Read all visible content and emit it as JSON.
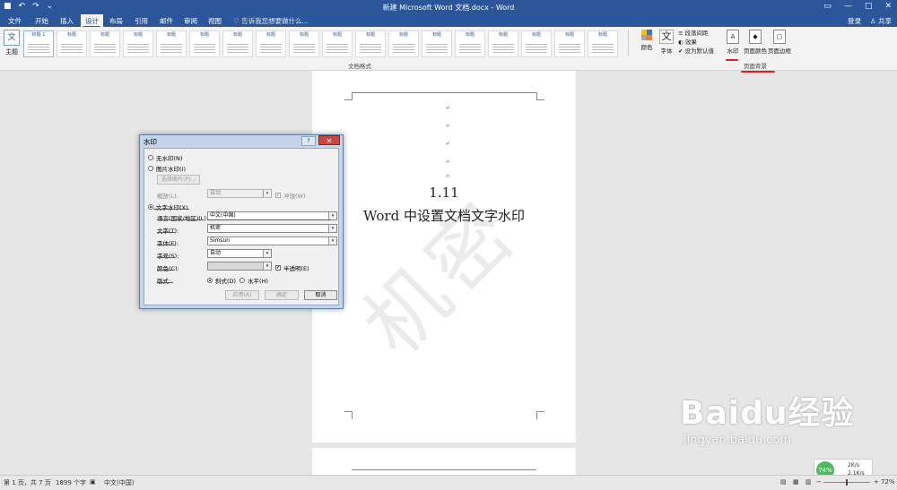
{
  "titlebar": {
    "title": "新建 Microsoft Word 文档.docx - Word",
    "qat": [
      "↶",
      "↷",
      "⌄"
    ],
    "controls": [
      "▭",
      "—",
      "□",
      "✕"
    ]
  },
  "tabs": [
    {
      "label": "文件"
    },
    {
      "label": "开始"
    },
    {
      "label": "插入"
    },
    {
      "label": "设计"
    },
    {
      "label": "布局"
    },
    {
      "label": "引用"
    },
    {
      "label": "邮件"
    },
    {
      "label": "审阅"
    },
    {
      "label": "视图"
    }
  ],
  "tell_me": "♡ 告诉我您想要做什么...",
  "login": "登录",
  "share": "♙ 共享",
  "ribbon": {
    "theme_label": "主题",
    "theme_icon_text": "文",
    "gallery_thumbs": [
      "标题 1",
      "标题",
      "标题",
      "标题",
      "标题",
      "标题",
      "标题",
      "标题",
      "标题",
      "标题",
      "标题",
      "标题",
      "标题",
      "标题",
      "标题",
      "标题",
      "标题",
      "标题",
      "标题"
    ],
    "color_label": "颜色",
    "font_label": "字体",
    "font_icon_text": "文",
    "paragraph_spacing": "段落间距",
    "effects": "效果",
    "set_default": "设为默认值",
    "group_doc_format": "文档格式",
    "watermark_label": "水印",
    "page_color_label": "页面颜色",
    "page_border_label": "页面边框",
    "group_page_bg": "页面背景"
  },
  "document": {
    "line1": "1.11",
    "line2": "Word 中设置文档文字水印",
    "watermark_text": "机密"
  },
  "dialog": {
    "title": "水印",
    "help": "?",
    "close": "✕",
    "no_watermark": "无水印(N)",
    "picture_watermark": "图片水印(I)",
    "select_picture": "选择图片(P)...",
    "scale_label": "缩放(L):",
    "scale_value": "自动",
    "washout": "冲蚀(W)",
    "text_watermark": "文字水印(X)",
    "language_label": "语言(国家/地区)(L):",
    "language_value": "中文(中国)",
    "text_label": "文字(T):",
    "text_value": "机密",
    "font_label": "字体(F):",
    "font_value": "Simsun",
    "size_label": "字号(S):",
    "size_value": "自动",
    "color_label": "颜色(C):",
    "semitransparent": "半透明(E)",
    "layout_label": "版式:",
    "diagonal": "斜式(D)",
    "horizontal": "水平(H)",
    "apply": "应用(A)",
    "ok": "确定",
    "cancel": "取消"
  },
  "status": {
    "page": "第 1 页，共 7 页",
    "words": "1899 个字",
    "language": "中文(中国)",
    "zoom": "72%"
  },
  "net_widget": {
    "percent": "74%",
    "up": "2K/s",
    "down": "2.1K/s"
  },
  "baidu": {
    "logo": "Baidu经验",
    "sub": "jingyan.baidu.com"
  },
  "colors": {
    "word_blue": "#2b579a",
    "annotation_red": "#e0201f"
  }
}
